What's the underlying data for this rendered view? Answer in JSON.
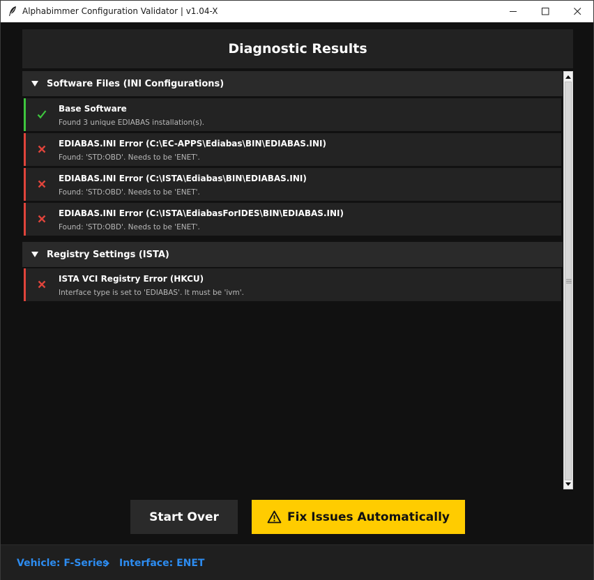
{
  "window": {
    "title": "Alphabimmer Configuration Validator | v1.04-X"
  },
  "header": {
    "title": "Diagnostic Results"
  },
  "sections": [
    {
      "label": "Software Files (INI Configurations)",
      "items": [
        {
          "status": "pass",
          "title": "Base Software",
          "detail": "Found 3 unique EDIABAS installation(s)."
        },
        {
          "status": "fail",
          "title": "EDIABAS.INI Error (C:\\EC-APPS\\Ediabas\\BIN\\EDIABAS.INI)",
          "detail": "Found: 'STD:OBD'. Needs to be 'ENET'."
        },
        {
          "status": "fail",
          "title": "EDIABAS.INI Error (C:\\ISTA\\Ediabas\\BIN\\EDIABAS.INI)",
          "detail": "Found: 'STD:OBD'. Needs to be 'ENET'."
        },
        {
          "status": "fail",
          "title": "EDIABAS.INI Error (C:\\ISTA\\EdiabasForIDES\\BIN\\EDIABAS.INI)",
          "detail": "Found: 'STD:OBD'. Needs to be 'ENET'."
        }
      ]
    },
    {
      "label": "Registry Settings (ISTA)",
      "items": [
        {
          "status": "fail",
          "title": "ISTA VCI Registry Error (HKCU)",
          "detail": "Interface type is set to 'EDIABAS'. It must be 'ivm'."
        }
      ]
    }
  ],
  "actions": {
    "start_over": "Start Over",
    "fix": "Fix Issues Automatically"
  },
  "statusbar": {
    "vehicle": "Vehicle: F-Series",
    "interface": "Interface: ENET"
  },
  "colors": {
    "pass": "#3ec63e",
    "fail": "#e0443b",
    "accent": "#ffcc00",
    "link": "#2d8cf0"
  },
  "icons": {
    "pass": "check-icon",
    "fail": "x-icon"
  }
}
